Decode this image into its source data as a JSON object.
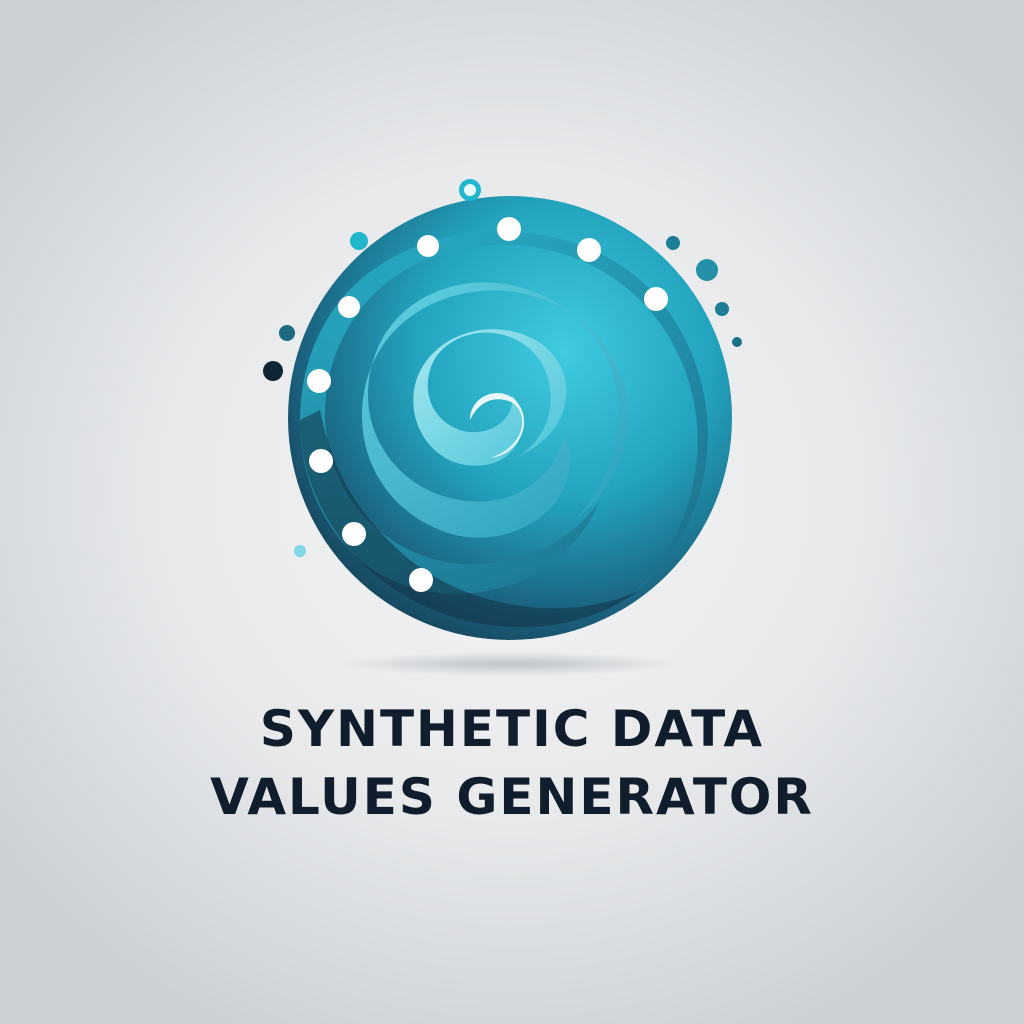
{
  "logo": {
    "icon": "swirl-data-points-icon",
    "colors": {
      "dark": "#143b50",
      "mid": "#1e8fa8",
      "light": "#3ac6dc",
      "pale": "#a7e6ee",
      "text": "#0f1d2c"
    },
    "title_lines": [
      "SYNTHETIC DATA",
      "VALUES GENERATOR"
    ]
  }
}
